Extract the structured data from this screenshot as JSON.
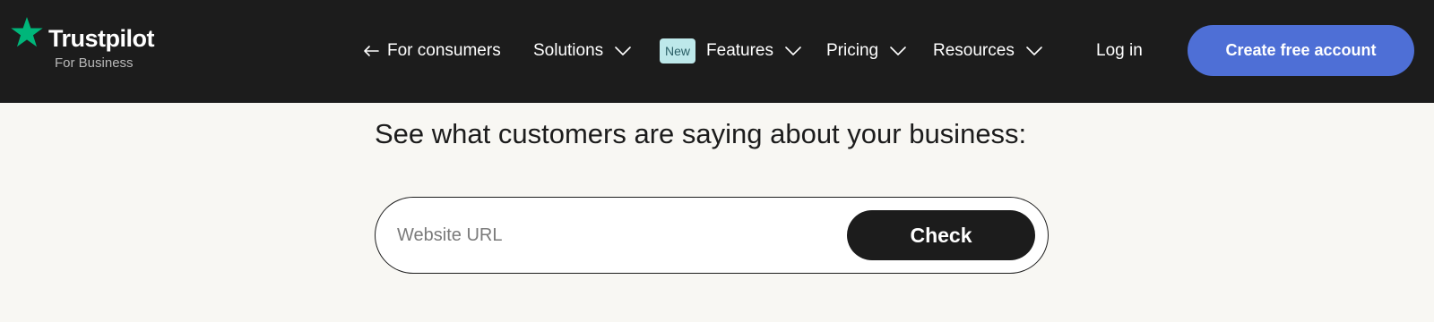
{
  "header": {
    "logo": {
      "brand": "Trustpilot",
      "subtitle": "For Business",
      "icon": "star-icon",
      "star_color": "#00b67a"
    },
    "nav": {
      "for_consumers": {
        "label": "For consumers",
        "icon": "arrow-left-icon"
      },
      "solutions": {
        "label": "Solutions",
        "icon": "chevron-down-icon"
      },
      "features": {
        "badge": "New",
        "label": "Features",
        "icon": "chevron-down-icon"
      },
      "pricing": {
        "label": "Pricing",
        "icon": "chevron-down-icon"
      },
      "resources": {
        "label": "Resources",
        "icon": "chevron-down-icon"
      }
    },
    "login_label": "Log in",
    "cta_label": "Create free account"
  },
  "main": {
    "headline": "See what customers are saying about your business:",
    "search": {
      "placeholder": "Website URL",
      "value": "",
      "button_label": "Check"
    }
  },
  "colors": {
    "nav_background": "#1c1c1c",
    "page_background": "#f8f7f3",
    "cta": "#4e6fd6",
    "badge_background": "#bde8ea",
    "button_dark": "#1c1c1c"
  }
}
